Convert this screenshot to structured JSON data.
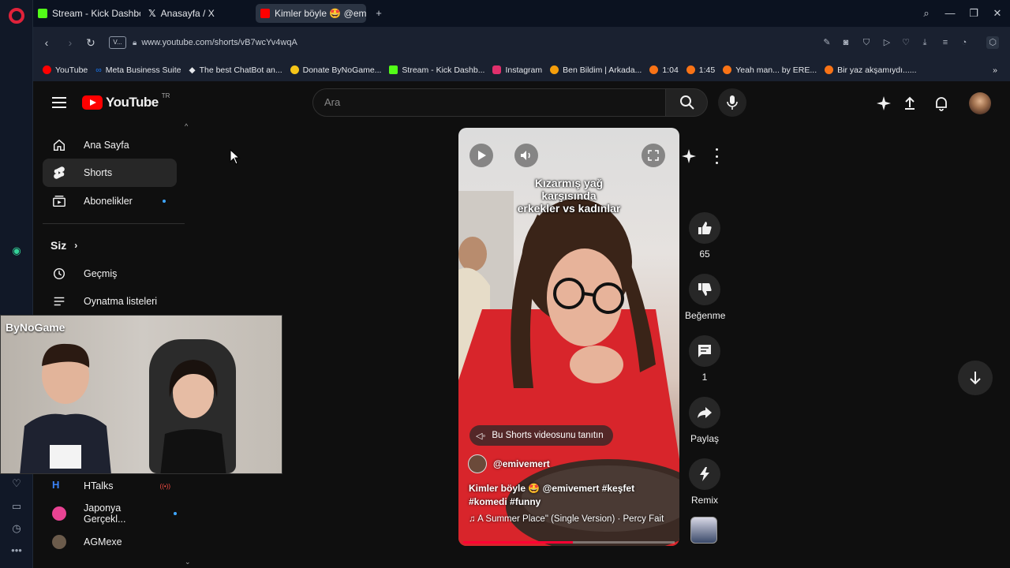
{
  "browser": {
    "tabs": [
      {
        "label": "Stream - Kick Dashboard",
        "color": "#53fc18"
      },
      {
        "label": "Anasayfa / X",
        "color": "#ffffff"
      },
      {
        "label": "Kimler böyle 🤩 @emiven",
        "color": "#ff0000"
      }
    ],
    "url_tag": "V...",
    "url": "www.youtube.com/shorts/vB7wcYv4wqA",
    "bookmarks": [
      {
        "label": "YouTube",
        "color": "#ff0000"
      },
      {
        "label": "Meta Business Suite",
        "color": "#1877f2"
      },
      {
        "label": "The best ChatBot an...",
        "color": "#ffffff"
      },
      {
        "label": "Donate ByNoGame...",
        "color": "#f5c518"
      },
      {
        "label": "Stream - Kick Dashb...",
        "color": "#53fc18"
      },
      {
        "label": "Instagram",
        "color": "#e1306c"
      },
      {
        "label": "Ben Bildim | Arkada...",
        "color": "#f59e0b"
      },
      {
        "label": "1:04",
        "color": "#f97316"
      },
      {
        "label": "1:45",
        "color": "#f97316"
      },
      {
        "label": "Yeah man... by ERE...",
        "color": "#f97316"
      },
      {
        "label": "Bir yaz akşamıydı......",
        "color": "#f97316"
      }
    ]
  },
  "youtube": {
    "logo_text": "YouTube",
    "region": "TR",
    "search_placeholder": "Ara",
    "guide": {
      "home": "Ana Sayfa",
      "shorts": "Shorts",
      "subscriptions": "Abonelikler",
      "you": "Siz",
      "history": "Geçmiş",
      "playlists": "Oynatma listeleri",
      "subs": [
        {
          "label": "HTalks"
        },
        {
          "label": "Japonya Gerçekl..."
        },
        {
          "label": "AGMexe"
        }
      ]
    },
    "webcam_brand": "ByNoGame",
    "short": {
      "caption_line1": "Kızarmış yağ",
      "caption_line2": "karşısında",
      "caption_line3": "erkekler vs kadınlar",
      "promo": "Bu Shorts videosunu tanıtın",
      "channel": "@emivemert",
      "title": "Kimler böyle 🤩 @emivemert #keşfet #komedi #funny",
      "music": "♫ A Summer Place\" (Single Version) · Percy Fait",
      "progress_fraction": 0.52
    },
    "actions": {
      "likes": "65",
      "dislike": "Beğenme",
      "comments": "1",
      "share": "Paylaş",
      "remix": "Remix"
    }
  }
}
